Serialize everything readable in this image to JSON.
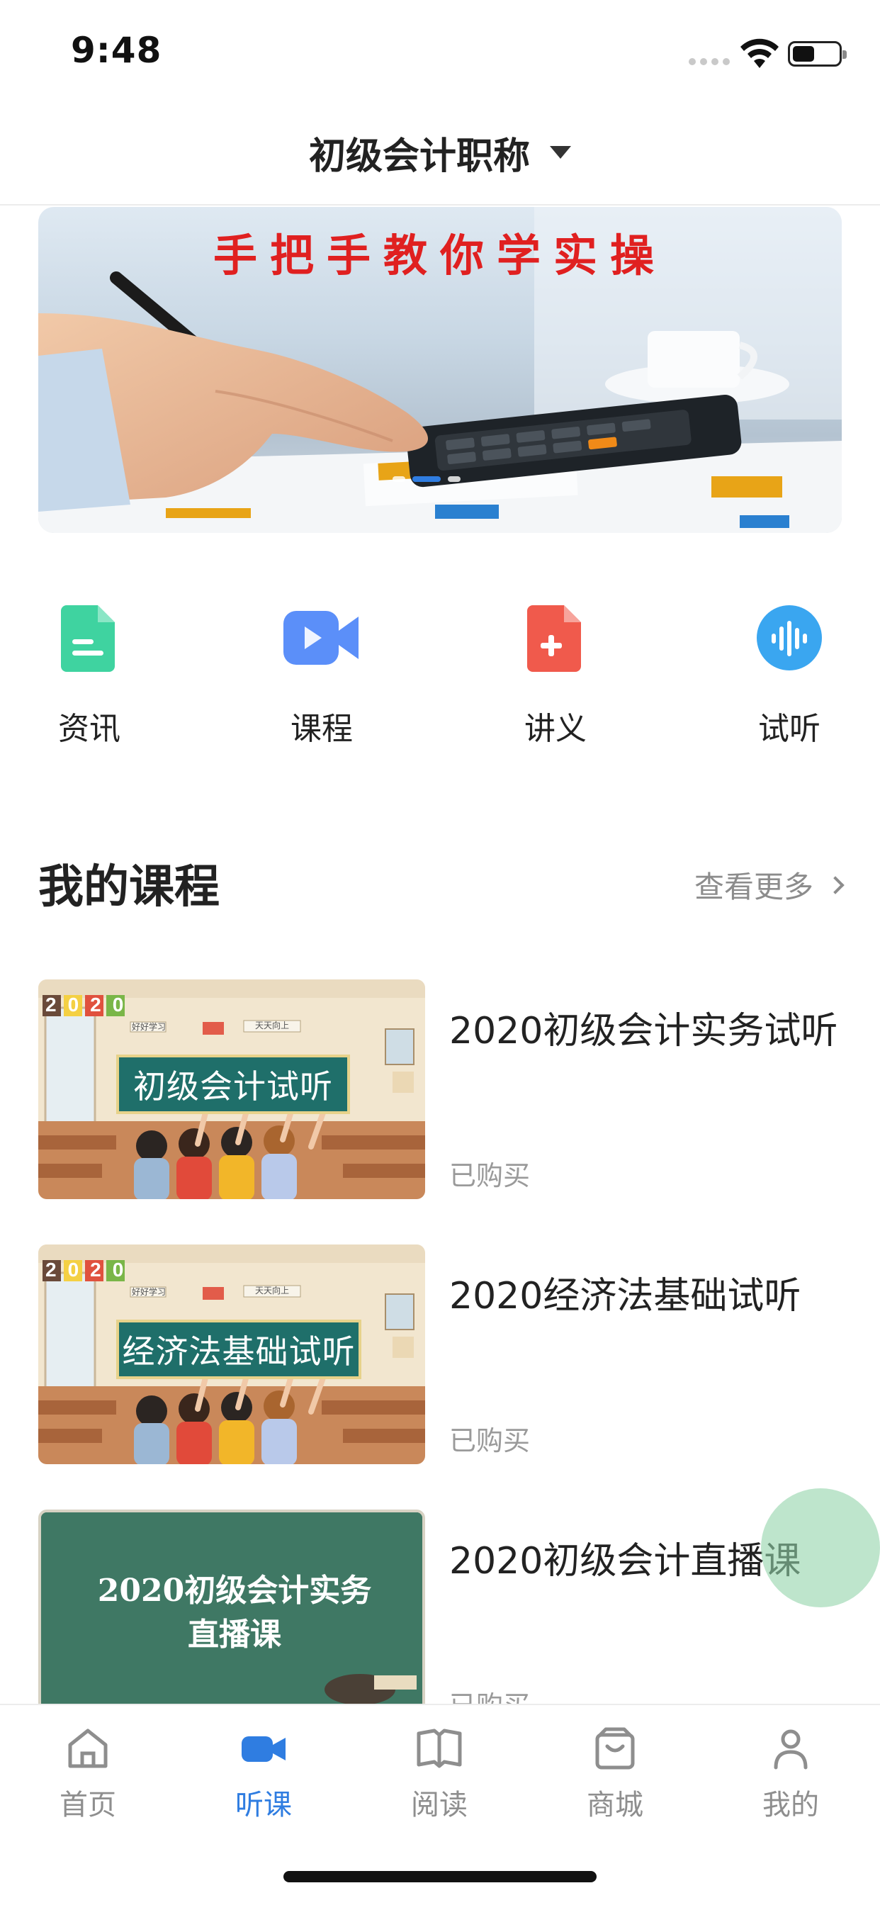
{
  "status_bar": {
    "time": "9:48"
  },
  "header": {
    "title": "初级会计职称"
  },
  "banner": {
    "title": "手把手教你学实操",
    "active_index": 1,
    "page_count": 3
  },
  "quick_entries": [
    {
      "label": "资讯",
      "icon": "document-icon",
      "color": "#3fd3a0"
    },
    {
      "label": "课程",
      "icon": "video-camera-icon",
      "color": "#5b8ff9"
    },
    {
      "label": "讲义",
      "icon": "add-file-icon",
      "color": "#f05a4c"
    },
    {
      "label": "试听",
      "icon": "audio-wave-icon",
      "color": "#3aa6f0"
    }
  ],
  "my_courses": {
    "title": "我的课程",
    "see_more": "查看更多",
    "items": [
      {
        "title": "2020初级会计实务试听",
        "status": "已购买",
        "thumb_year": "2020",
        "thumb_label": "初级会计试听",
        "thumb_sign_left": "好好学习",
        "thumb_sign_right": "天天向上"
      },
      {
        "title": "2020经济法基础试听",
        "status": "已购买",
        "thumb_year": "2020",
        "thumb_label": "经济法基础试听",
        "thumb_sign_left": "好好学习",
        "thumb_sign_right": "天天向上"
      },
      {
        "title": "2020初级会计直播课",
        "status": "已购买",
        "thumb_line1": "2020初级会计实务",
        "thumb_line2": "直播课"
      }
    ]
  },
  "tabbar": {
    "active": "听课",
    "accent": "#2f7de1",
    "items": [
      {
        "label": "首页",
        "icon": "home-icon"
      },
      {
        "label": "听课",
        "icon": "video-camera-icon"
      },
      {
        "label": "阅读",
        "icon": "open-book-icon"
      },
      {
        "label": "商城",
        "icon": "shopping-bag-icon"
      },
      {
        "label": "我的",
        "icon": "profile-icon"
      }
    ]
  }
}
